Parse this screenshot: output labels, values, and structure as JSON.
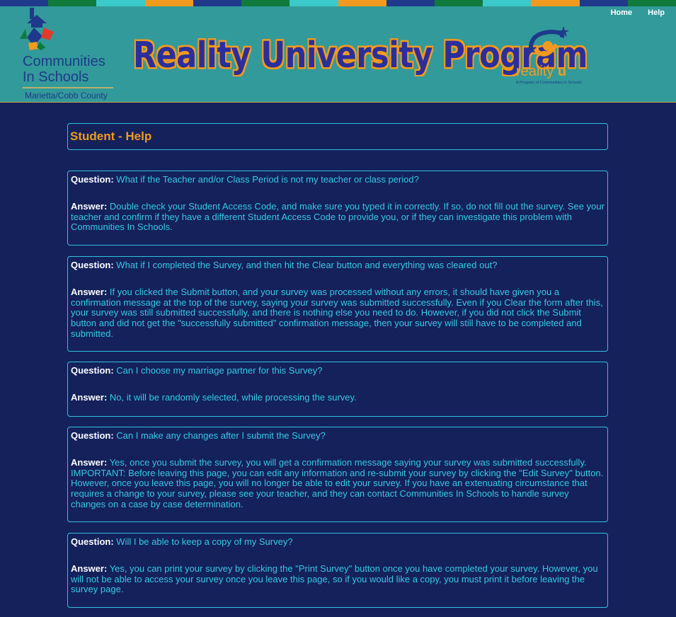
{
  "nav": {
    "home": "Home",
    "help": "Help"
  },
  "header": {
    "org_line1": "Communities",
    "org_line2": "In Schools",
    "org_location": "Marietta/Cobb County",
    "program_title": "Reality University Program",
    "ru_brand_reality": "reality",
    "ru_brand_u": "u",
    "ru_tagline": "A Program of Communities In Schools",
    "stripe_colors": [
      "#1f3a8a",
      "#0f7a3c",
      "#3cc9c9",
      "#f29a1e",
      "#1f3a8a",
      "#0f7a3c",
      "#3cc9c9",
      "#f29a1e",
      "#1f3a8a",
      "#0f7a3c",
      "#3cc9c9",
      "#f29a1e",
      "#1f3a8a",
      "#0f7a3c"
    ]
  },
  "page": {
    "title": "Student - Help"
  },
  "labels": {
    "question": "Question:",
    "answer": "Answer:"
  },
  "faq": [
    {
      "question": "What if the Teacher and/or Class Period is not my teacher or class period?",
      "answer": "Double check your Student Access Code, and make sure you typed it in correctly. If so, do not fill out the survey. See your teacher and confirm if they have a different Student Access Code to provide you, or if they can investigate this problem with Communities In Schools."
    },
    {
      "question": "What if I completed the Survey, and then hit the Clear button and everything was cleared out?",
      "answer": "If you clicked the Submit button, and your survey was processed without any errors, it should have given you a confirmation message at the top of the survey, saying your survey was submitted successfully. Even if you Clear the form after this, your survey was still submitted successfully, and there is nothing else you need to do. However, if you did not click the Submit button and did not get the \"successfully submitted\" confirmation message, then your survey will still have to be completed and submitted."
    },
    {
      "question": "Can I choose my marriage partner for this Survey?",
      "answer": "No, it will be randomly selected, while processing the survey."
    },
    {
      "question": "Can I make any changes after I submit the Survey?",
      "answer": "Yes, once you submit the survey, you will get a confirmation message saying your survey was submitted successfully. IMPORTANT: Before leaving this page, you can edit any information and re-submit your survey by clicking the \"Edit Survey\" button. However, once you leave this page, you will no longer be able to edit your survey. If you have an extenuating circumstance that requires a change to your survey, please see your teacher, and they can contact Communities In Schools to handle survey changes on a case by case determination."
    },
    {
      "question": "Will I be able to keep a copy of my Survey?",
      "answer": "Yes, you can print your survey by clicking the \"Print Survey\" button once you have completed your survey. However, you will not be able to access your survey once you leave this page, so if you would like a copy, you must print it before leaving the survey page."
    }
  ]
}
